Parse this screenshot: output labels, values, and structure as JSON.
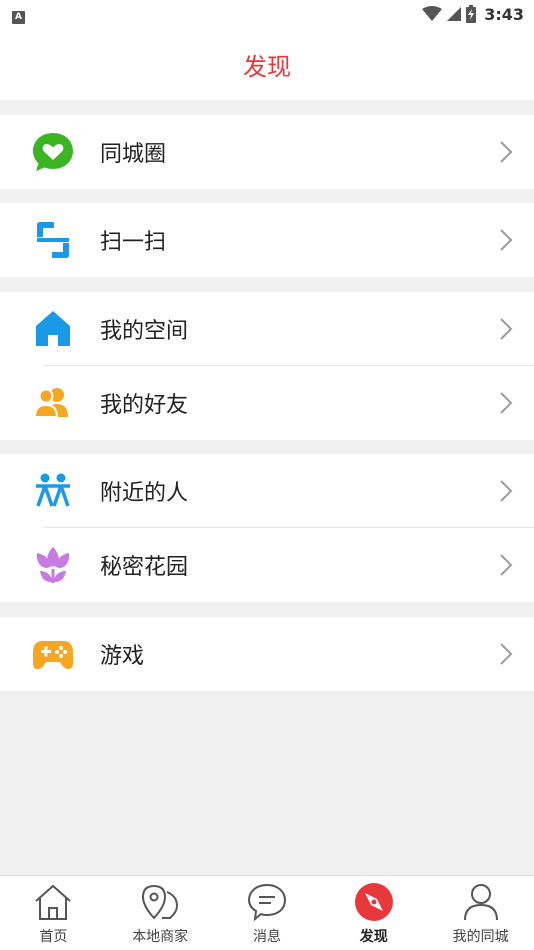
{
  "status_bar": {
    "app_badge": "A",
    "time": "3:43"
  },
  "header": {
    "title": "发现"
  },
  "menu": {
    "items": [
      {
        "label": "同城圈",
        "icon": "heart-bubble-icon"
      },
      {
        "label": "扫一扫",
        "icon": "scan-icon"
      },
      {
        "label": "我的空间",
        "icon": "home-icon"
      },
      {
        "label": "我的好友",
        "icon": "friends-icon"
      },
      {
        "label": "附近的人",
        "icon": "nearby-people-icon"
      },
      {
        "label": "秘密花园",
        "icon": "flower-icon"
      },
      {
        "label": "游戏",
        "icon": "gamepad-icon"
      }
    ]
  },
  "tabbar": {
    "tabs": [
      {
        "label": "首页",
        "icon": "home-outline-icon"
      },
      {
        "label": "本地商家",
        "icon": "location-pin-icon"
      },
      {
        "label": "消息",
        "icon": "chat-bubble-icon"
      },
      {
        "label": "发现",
        "icon": "compass-icon"
      },
      {
        "label": "我的同城",
        "icon": "user-icon"
      }
    ],
    "active_index": 3
  },
  "colors": {
    "accent": "#e8373a",
    "background": "#f0f0f0"
  }
}
